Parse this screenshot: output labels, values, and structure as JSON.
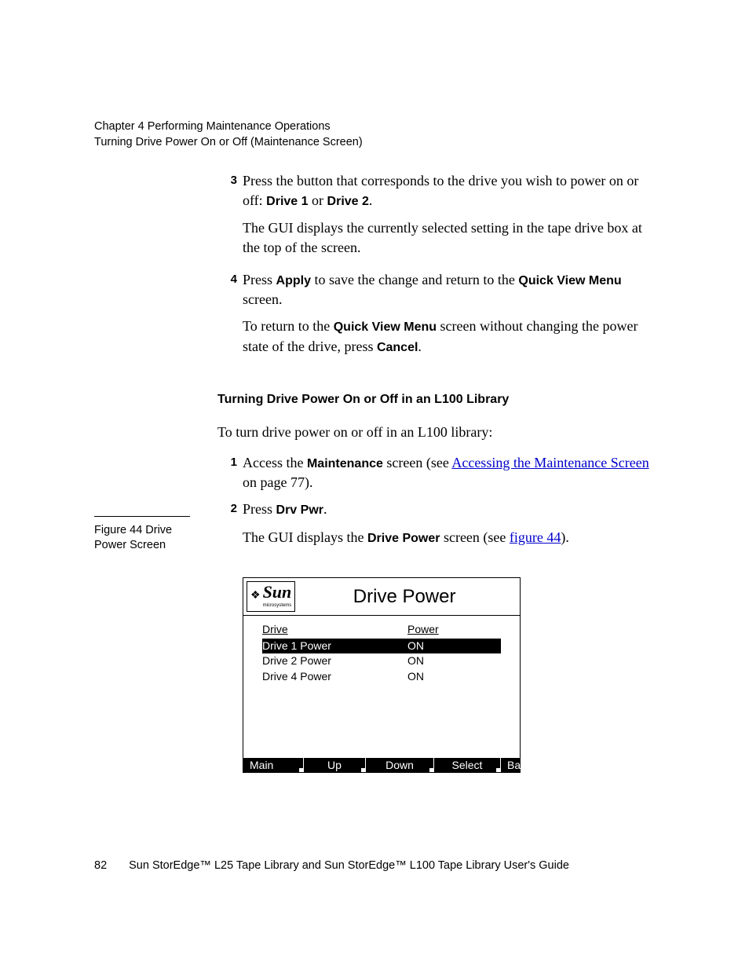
{
  "header": {
    "chapter": "Chapter 4  Performing Maintenance Operations",
    "section": "Turning Drive Power On or Off (Maintenance Screen)"
  },
  "steps_a": [
    {
      "num": "3",
      "text_before": "Press the button that corresponds to the drive you wish to power on or off: ",
      "bold1": "Drive 1",
      "mid1": " or ",
      "bold2": "Drive 2",
      "after": ".",
      "follow": "The GUI displays the currently selected setting in the tape drive box at the top of the screen."
    },
    {
      "num": "4",
      "text_before": "Press ",
      "bold1": "Apply",
      "mid1": " to save the change and return to the ",
      "bold2": "Quick View Menu",
      "after": " screen.",
      "follow_before": "To return to the ",
      "follow_bold1": "Quick View Menu",
      "follow_mid": " screen without changing the power state of the drive, press ",
      "follow_bold2": "Cancel",
      "follow_after": "."
    }
  ],
  "section_heading": "Turning Drive Power On or Off in an L100 Library",
  "intro": "To turn drive power on or off in an L100 library:",
  "steps_b": [
    {
      "num": "1",
      "before": "Access the ",
      "bold": "Maintenance",
      "mid": " screen (see ",
      "link": "Accessing the Maintenance Screen",
      "after": " on page 77)."
    },
    {
      "num": "2",
      "before": "Press ",
      "bold": "Drv Pwr",
      "after": "."
    }
  ],
  "gui_line": {
    "before": "The GUI displays the ",
    "bold": "Drive Power",
    "mid": " screen (see ",
    "link": "figure 44",
    "after": ")."
  },
  "sidebar": {
    "label": "Figure 44  Drive Power Screen"
  },
  "figure": {
    "logo_word": "Sun",
    "logo_sub": "microsystems",
    "title": "Drive Power",
    "col_drive": "Drive",
    "col_power": "Power",
    "rows": [
      {
        "drive": "Drive 1 Power",
        "power": "ON",
        "selected": true
      },
      {
        "drive": "Drive 2 Power",
        "power": "ON",
        "selected": false
      },
      {
        "drive": "Drive 4 Power",
        "power": "ON",
        "selected": false
      }
    ],
    "buttons": {
      "main": "Main",
      "up": "Up",
      "down": "Down",
      "select": "Select",
      "back": "Back"
    }
  },
  "footer": {
    "page": "82",
    "title": "Sun StorEdge™ L25 Tape Library and Sun StorEdge™ L100 Tape Library User's Guide"
  }
}
